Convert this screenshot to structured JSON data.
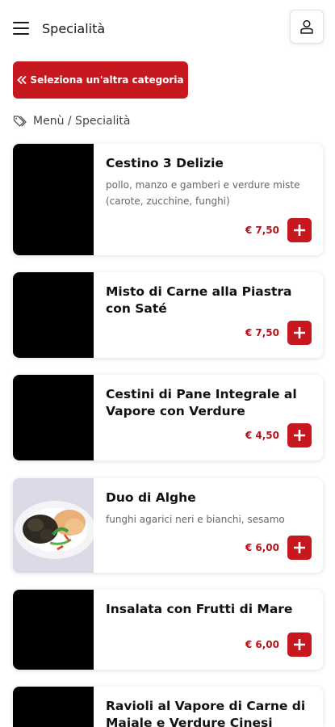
{
  "header": {
    "title": "Specialità",
    "menu_icon": "hamburger-menu-icon",
    "user_icon": "user-icon"
  },
  "back_button": {
    "icon": "double-chevron-left-icon",
    "label": "Seleziona un'altra categoria"
  },
  "breadcrumb": {
    "icon": "tags-icon",
    "text": "Menù / Specialità"
  },
  "colors": {
    "accent": "#c8181f",
    "price": "#b5121b"
  },
  "items": [
    {
      "title": "Cestino 3 Delizie",
      "description": "pollo, manzo e gamberi e verdure miste (carote, zucchine, funghi)",
      "price": "€ 7,50",
      "image": "black-placeholder"
    },
    {
      "title": "Misto di Carne alla Piastra con Saté",
      "description": "",
      "price": "€ 7,50",
      "image": "black-placeholder"
    },
    {
      "title": "Cestini di Pane Integrale al Vapore con Verdure",
      "description": "",
      "price": "€ 4,50",
      "image": "black-placeholder"
    },
    {
      "title": "Duo di Alghe",
      "description": "funghi agarici neri e bianchi, sesamo",
      "price": "€ 6,00",
      "image": "seaweed-dish-photo"
    },
    {
      "title": "Insalata con Frutti di Mare",
      "description": "",
      "price": "€ 6,00",
      "image": "black-placeholder"
    },
    {
      "title": "Ravioli al Vapore di Carne di Maiale e Verdure Cinesi",
      "description": "",
      "price": "",
      "image": "black-placeholder"
    }
  ]
}
